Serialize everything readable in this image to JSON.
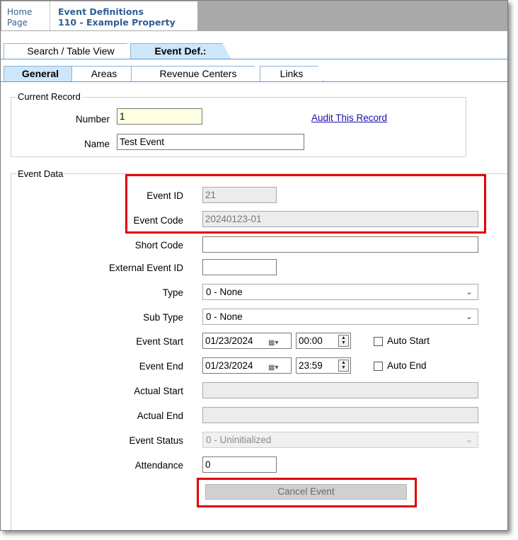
{
  "header": {
    "home_line1": "Home",
    "home_line2": "Page",
    "title_line1": "Event Definitions",
    "title_line2": "110 - Example Property"
  },
  "outer_tabs": [
    {
      "label": "Search / Table View",
      "selected": false
    },
    {
      "label": "Event Def.:",
      "selected": true
    }
  ],
  "inner_tabs": [
    {
      "label": "General",
      "selected": true
    },
    {
      "label": "Areas",
      "selected": false
    },
    {
      "label": "Revenue Centers",
      "selected": false
    },
    {
      "label": "Links",
      "selected": false
    }
  ],
  "current_record": {
    "group_label": "Current Record",
    "number_label": "Number",
    "number_value": "1",
    "name_label": "Name",
    "name_value": "Test Event",
    "audit_link": "Audit This Record"
  },
  "event_data": {
    "group_label": "Event Data",
    "event_id_label": "Event ID",
    "event_id_value": "21",
    "event_code_label": "Event Code",
    "event_code_value": "20240123-01",
    "short_code_label": "Short Code",
    "short_code_value": "",
    "external_event_id_label": "External Event ID",
    "external_event_id_value": "",
    "type_label": "Type",
    "type_value": "0 - None",
    "sub_type_label": "Sub Type",
    "sub_type_value": "0 - None",
    "event_start_label": "Event Start",
    "event_start_date": "01/23/2024",
    "event_start_time": "00:00",
    "auto_start_label": "Auto Start",
    "event_end_label": "Event End",
    "event_end_date": "01/23/2024",
    "event_end_time": "23:59",
    "auto_end_label": "Auto End",
    "actual_start_label": "Actual Start",
    "actual_start_value": "",
    "actual_end_label": "Actual End",
    "actual_end_value": "",
    "event_status_label": "Event Status",
    "event_status_value": "0 - Uninitialized",
    "attendance_label": "Attendance",
    "attendance_value": "0",
    "cancel_button": "Cancel Event"
  },
  "colors": {
    "highlight_border": "#e00000",
    "tab_selected": "#cde6fa",
    "link": "#1a0dab",
    "number_field_bg": "#ffffe1"
  }
}
